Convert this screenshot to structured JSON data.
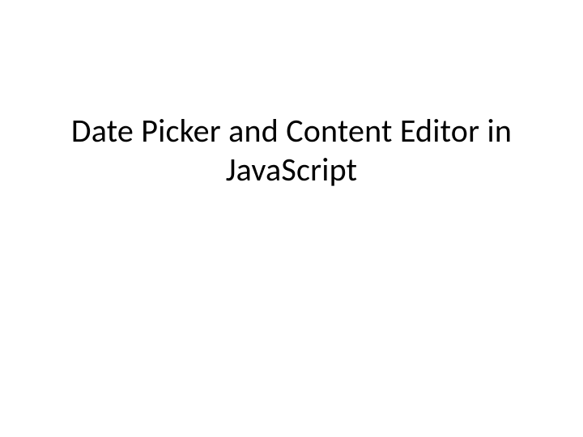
{
  "slide": {
    "title": "Date Picker and Content Editor in JavaScript"
  }
}
